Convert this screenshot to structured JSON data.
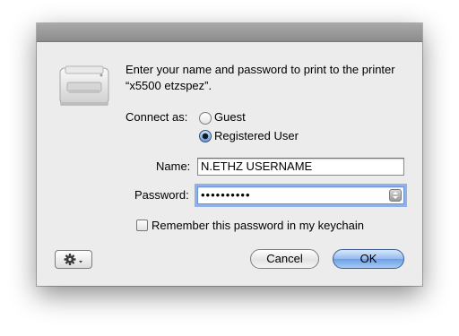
{
  "dialog": {
    "message": "Enter your name and password to print to the printer “x5500 etzspez”.",
    "connect_as_label": "Connect as:",
    "options": [
      {
        "label": "Guest",
        "selected": false
      },
      {
        "label": "Registered User",
        "selected": true
      }
    ],
    "name_label": "Name:",
    "name_value": "N.ETHZ USERNAME",
    "password_label": "Password:",
    "password_value": "••••••••••",
    "remember_label": "Remember this password in my keychain",
    "remember_checked": false,
    "cancel_label": "Cancel",
    "ok_label": "OK",
    "icons": {
      "printer": "printer-icon",
      "action": "gear-icon",
      "keychain": "key-icon"
    }
  }
}
